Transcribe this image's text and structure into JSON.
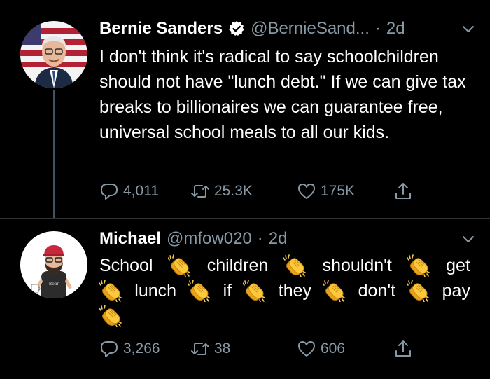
{
  "colors": {
    "background": "#000000",
    "text": "#ffffff",
    "muted": "#8899a6",
    "verified": "#ffffff",
    "thread_line": "#3d5466"
  },
  "tweets": [
    {
      "author": "Bernie Sanders",
      "handle": "@BernieSand...",
      "separator": "·",
      "time": "2d",
      "verified": true,
      "text": "I don't think it's radical to say schoolchildren should not have \"lunch debt.\" If we can give tax breaks to billionaires we can guarantee free, universal school meals to all our kids.",
      "replies": "4,011",
      "retweets": "25.3K",
      "likes": "175K"
    },
    {
      "author": "Michael",
      "handle": "@mfow020",
      "separator": "·",
      "time": "2d",
      "verified": false,
      "words": [
        "School",
        "children",
        "shouldn't",
        "get",
        "lunch",
        "if",
        "they",
        "don't",
        "pay"
      ],
      "clap_emoji": "clapping-hands-emoji",
      "replies": "3,266",
      "retweets": "38",
      "likes": "606"
    }
  ]
}
